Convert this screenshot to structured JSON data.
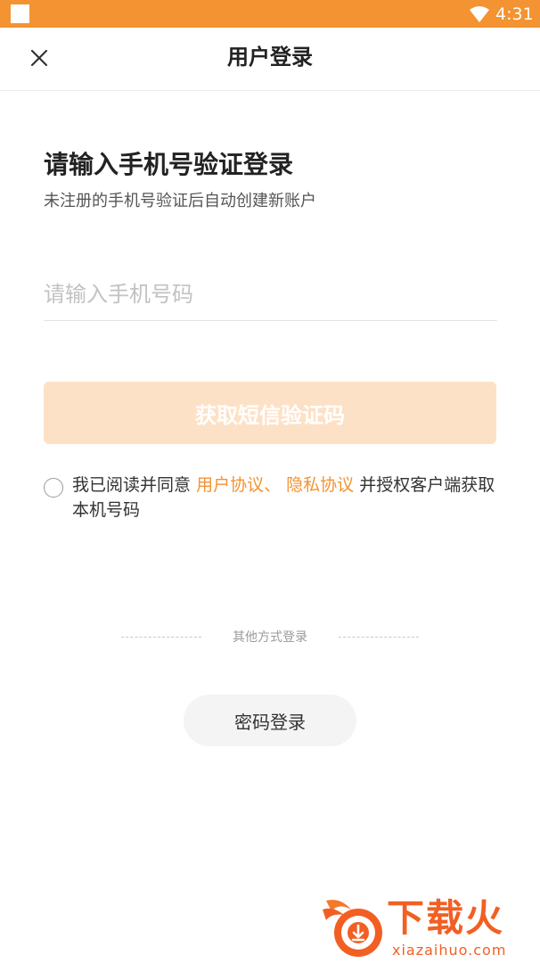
{
  "status_bar": {
    "time": "4:31",
    "color": "#f39331",
    "icons": [
      "notification-square-icon",
      "wifi-icon"
    ]
  },
  "header": {
    "title": "用户登录",
    "close_icon": "close-icon"
  },
  "intro": {
    "title": "请输入手机号验证登录",
    "subtitle": "未注册的手机号验证后自动创建新账户"
  },
  "phone_input": {
    "placeholder": "请输入手机号码",
    "value": ""
  },
  "get_code_button": {
    "label": "获取短信验证码",
    "color": "#fde1c6",
    "enabled": false
  },
  "agreement": {
    "checked": false,
    "prefix": "我已阅读并同意",
    "user_agreement": "用户协议、",
    "privacy_policy": "隐私协议",
    "suffix": "并授权客户端获取本机号码",
    "link_color": "#f39331"
  },
  "other_login": {
    "divider_text": "其他方式登录",
    "password_login": "密码登录"
  },
  "watermark": {
    "title": "下载火",
    "domain": "xiazaihuo.com",
    "color": "#f25f23"
  }
}
